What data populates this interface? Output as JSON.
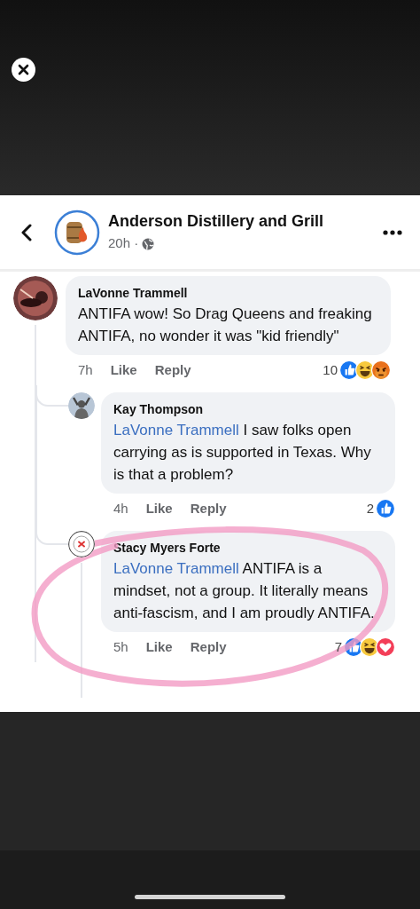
{
  "page": {
    "name": "Anderson Distillery and Grill",
    "time": "20h ·"
  },
  "comments": [
    {
      "author": "LaVonne Trammell",
      "text": "ANTIFA wow! So Drag Queens and freaking ANTIFA, no wonder it was \"kid friendly\"",
      "time": "7h",
      "actions": [
        "Like",
        "Reply"
      ],
      "reaction_count": "10",
      "reactions": [
        {
          "kind": "like"
        },
        {
          "kind": "haha"
        },
        {
          "kind": "angry"
        }
      ],
      "has_replies": true,
      "children": [
        {
          "author": "Kay Thompson",
          "mention": "LaVonne Trammell",
          "text": "I saw folks open carrying as is supported in Texas. Why is that a problem?",
          "time": "4h",
          "actions": [
            "Like",
            "Reply"
          ],
          "reaction_count": "2",
          "reactions": [
            {
              "kind": "like"
            }
          ],
          "has_replies": false
        },
        {
          "author": "Stacy Myers Forte",
          "mention": "LaVonne Trammell",
          "text": "ANTIFA is a mindset, not a group. It literally means anti-fascism, and I am proudly ANTIFA.",
          "time": "5h",
          "actions": [
            "Like",
            "Reply"
          ],
          "reaction_count": "7",
          "reactions": [
            {
              "kind": "like"
            },
            {
              "kind": "haha"
            },
            {
              "kind": "love"
            }
          ],
          "has_replies": true
        }
      ]
    }
  ]
}
